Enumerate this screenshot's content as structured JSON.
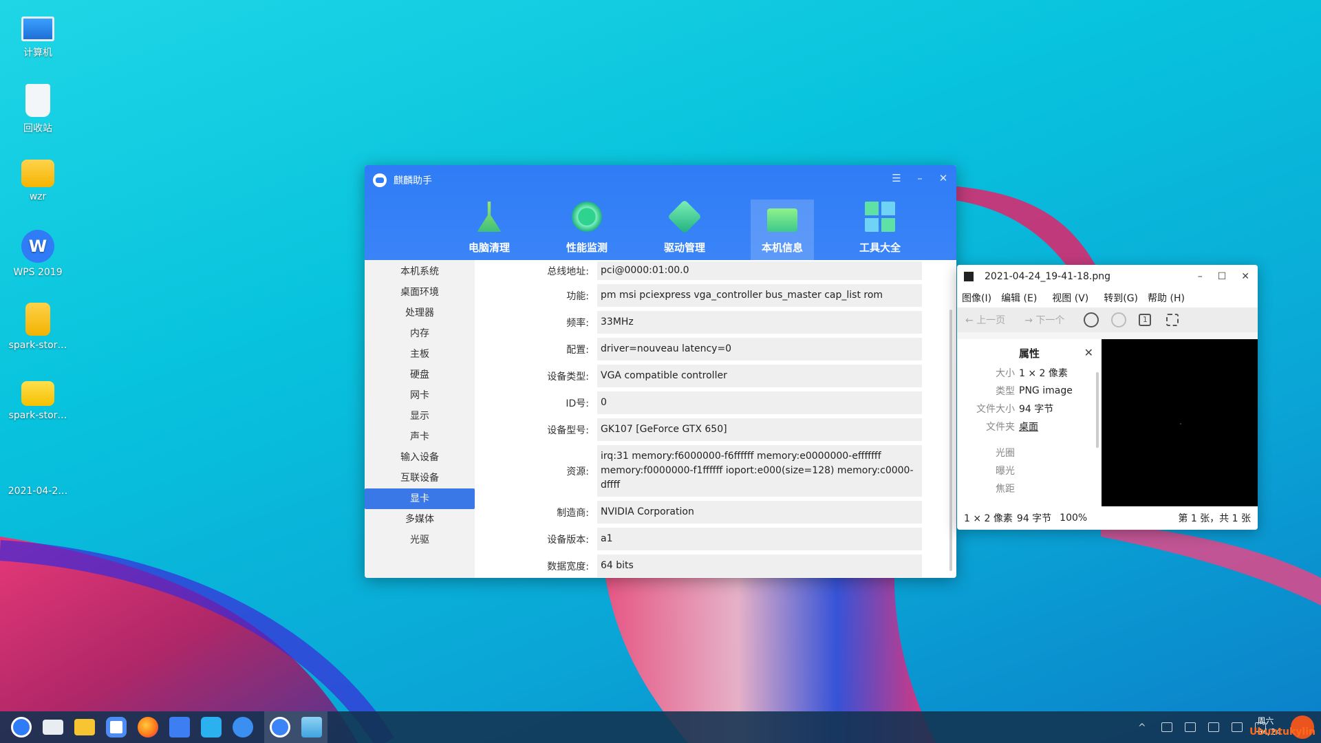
{
  "desktop": {
    "icons": [
      {
        "label": "计算机",
        "icon": "monitor-icon"
      },
      {
        "label": "回收站",
        "icon": "trash-icon"
      },
      {
        "label": "wzr",
        "icon": "home-folder-icon"
      },
      {
        "label": "WPS 2019",
        "icon": "wps-icon"
      },
      {
        "label": "spark-stor…",
        "icon": "zip-file-icon"
      },
      {
        "label": "spark-stor…",
        "icon": "folder-icon"
      },
      {
        "label": "2021-04-2…",
        "icon": "image-file-icon"
      }
    ]
  },
  "main_window": {
    "title": "麒麟助手",
    "controls": {
      "menu": "☰",
      "minimize": "–",
      "close": "✕"
    },
    "tabs": [
      {
        "label": "电脑清理",
        "icon": "broom-icon",
        "color": "#7ed957"
      },
      {
        "label": "性能监测",
        "icon": "gauge-icon",
        "color": "#25c98b"
      },
      {
        "label": "驱动管理",
        "icon": "cube-icon",
        "color": "#3ddc9a"
      },
      {
        "label": "本机信息",
        "icon": "monitor-icon",
        "color": "#6be27e"
      },
      {
        "label": "工具大全",
        "icon": "grid-icon",
        "color": "#4fd9a3"
      }
    ],
    "sidebar": [
      "本机系统",
      "桌面环境",
      "处理器",
      "内存",
      "主板",
      "硬盘",
      "网卡",
      "显示",
      "声卡",
      "输入设备",
      "互联设备",
      "显卡",
      "多媒体",
      "光驱"
    ],
    "active_sidebar": "显卡",
    "details": [
      {
        "key": "总线地址:",
        "value": "pci@0000:01:00.0"
      },
      {
        "key": "功能:",
        "value": "pm msi pciexpress vga_controller bus_master cap_list rom"
      },
      {
        "key": "频率:",
        "value": "33MHz"
      },
      {
        "key": "配置:",
        "value": "driver=nouveau latency=0"
      },
      {
        "key": "设备类型:",
        "value": "VGA compatible controller"
      },
      {
        "key": "ID号:",
        "value": "0"
      },
      {
        "key": "设备型号:",
        "value": "GK107 [GeForce GTX 650]"
      },
      {
        "key": "资源:",
        "value": "irq:31 memory:f6000000-f6ffffff memory:e0000000-efffffff memory:f0000000-f1ffffff ioport:e000(size=128) memory:c0000-dffff"
      },
      {
        "key": "制造商:",
        "value": "NVIDIA Corporation"
      },
      {
        "key": "设备版本:",
        "value": "a1"
      },
      {
        "key": "数据宽度:",
        "value": "64 bits"
      }
    ]
  },
  "viewer": {
    "title": "2021-04-24_19-41-18.png",
    "menu": [
      "图像(I)",
      "编辑 (E)",
      "视图 (V)",
      "转到(G)",
      "帮助 (H)"
    ],
    "toolbar": {
      "prev": "上一页",
      "next": "下一个"
    },
    "properties": {
      "title": "属性",
      "rows": [
        {
          "k": "大小",
          "v": "1 × 2 像素"
        },
        {
          "k": "类型",
          "v": "PNG image"
        },
        {
          "k": "文件大小",
          "v": "94 字节"
        },
        {
          "k": "文件夹",
          "v": "桌面"
        },
        {
          "k": "光圈",
          "v": ""
        },
        {
          "k": "曝光",
          "v": ""
        },
        {
          "k": "焦距",
          "v": ""
        }
      ]
    },
    "status": {
      "dims": "1 × 2 像素",
      "size": "94 字节",
      "zoom": "100%",
      "page": "第 1 张，共 1 张"
    }
  },
  "taskbar": {
    "apps": [
      {
        "name": "start-menu",
        "color": "#2f7cf6"
      },
      {
        "name": "show-desktop",
        "color": "#e8edf2"
      },
      {
        "name": "file-manager",
        "color": "#f7c531"
      },
      {
        "name": "search",
        "color": "#4d8bf5"
      },
      {
        "name": "firefox",
        "color": "#ff7a1a"
      },
      {
        "name": "wps-writer",
        "color": "#3d7ef2"
      },
      {
        "name": "software-store",
        "color": "#2bb0f0"
      },
      {
        "name": "media-player",
        "color": "#3a8ff0"
      },
      {
        "name": "kylin-assistant",
        "color": "#3a84f7"
      },
      {
        "name": "image-viewer",
        "color": "#57b3e8"
      }
    ],
    "clock": {
      "weekday": "周六",
      "date": "04/24"
    },
    "brand": "Ubuntukylin"
  }
}
